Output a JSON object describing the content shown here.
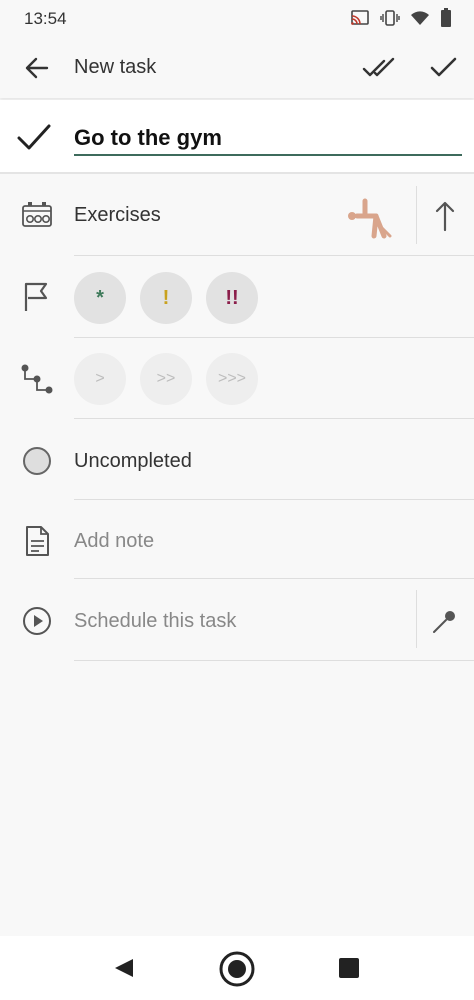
{
  "status": {
    "time": "13:54"
  },
  "app_bar": {
    "title": "New task"
  },
  "task": {
    "name": "Go to the gym"
  },
  "rows": {
    "category": "Exercises",
    "priority": [
      "*",
      "!",
      "!!"
    ],
    "difficulty": [
      ">",
      ">>",
      ">>>"
    ],
    "status": "Uncompleted",
    "note_placeholder": "Add note",
    "schedule_label": "Schedule this task"
  },
  "colors": {
    "accent": "#3e6b5c",
    "priority_low": "#3e7a5a",
    "priority_mid": "#c9a21e",
    "priority_high": "#8b1e4a",
    "category_icon": "#d9a58c"
  }
}
